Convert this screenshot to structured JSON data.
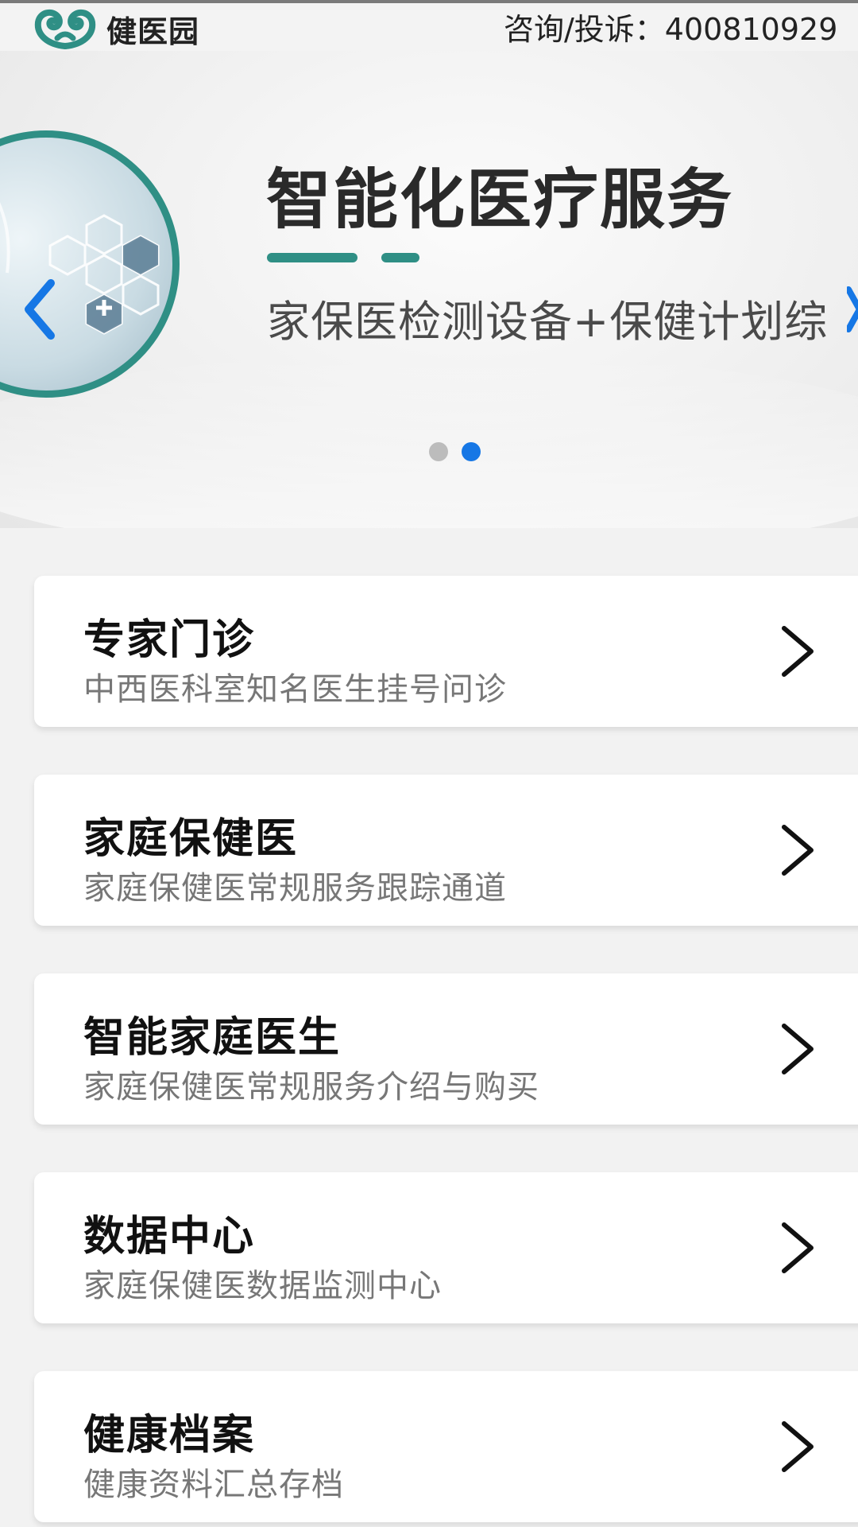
{
  "header": {
    "brand_name": "健医园",
    "hotline": "咨询/投诉：400810929",
    "logo_color": "#2f8f85"
  },
  "banner": {
    "title": "智能化医疗服务",
    "subtitle": "家保医检测设备+保健计划综",
    "accent_color": "#2f8f85",
    "active_slide": 2,
    "slide_count": 2,
    "prev_icon": "chevron-left-icon",
    "next_icon": "chevron-right-icon"
  },
  "menu": [
    {
      "title": "专家门诊",
      "desc": "中西医科室知名医生挂号问诊"
    },
    {
      "title": "家庭保健医",
      "desc": "家庭保健医常规服务跟踪通道"
    },
    {
      "title": "智能家庭医生",
      "desc": "家庭保健医常规服务介绍与购买"
    },
    {
      "title": "数据中心",
      "desc": "家庭保健医数据监测中心"
    },
    {
      "title": "健康档案",
      "desc": "健康资料汇总存档"
    }
  ],
  "colors": {
    "dot_active": "#1677e5",
    "dot_inactive": "#bcbcbc",
    "card_bg": "#ffffff",
    "page_bg": "#f2f2f2"
  }
}
